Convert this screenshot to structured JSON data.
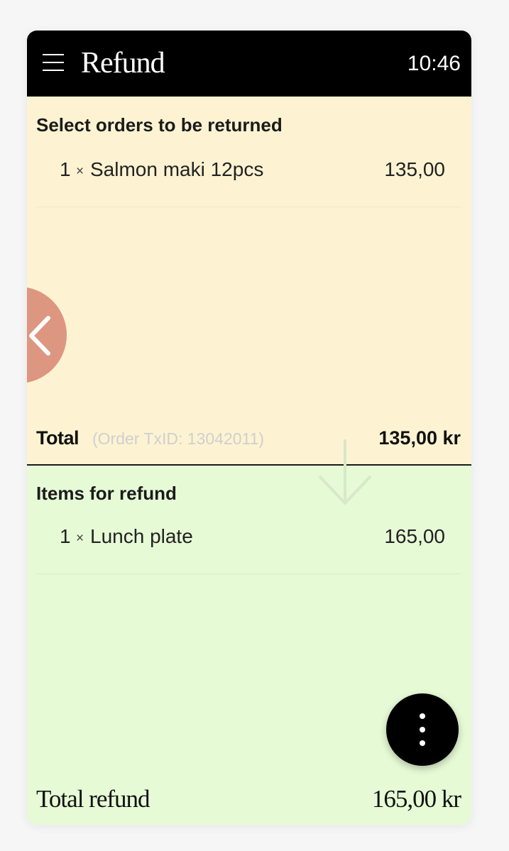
{
  "app": {
    "title": "Refund",
    "time": "10:46"
  },
  "orders": {
    "heading": "Select orders to be returned",
    "items": [
      {
        "qty": "1",
        "times": "×",
        "name": "Salmon maki 12pcs",
        "price": "135,00"
      }
    ],
    "total_label": "Total",
    "txid": "(Order TxID: 13042011)",
    "total_amount": "135,00 kr"
  },
  "refund": {
    "heading": "Items for refund",
    "items": [
      {
        "qty": "1",
        "times": "×",
        "name": "Lunch plate",
        "price": "165,00"
      }
    ],
    "total_label": "Total refund",
    "total_amount": "165,00 kr"
  },
  "colors": {
    "appbar": "#000000",
    "orders_bg": "#fdf3d2",
    "refund_bg": "#e6fad6",
    "back_button": "#dd9680",
    "fab": "#000000"
  },
  "icons": {
    "menu": "hamburger-menu-icon",
    "back": "chevron-left-icon",
    "arrow": "arrow-down-icon",
    "more": "more-vertical-icon"
  }
}
